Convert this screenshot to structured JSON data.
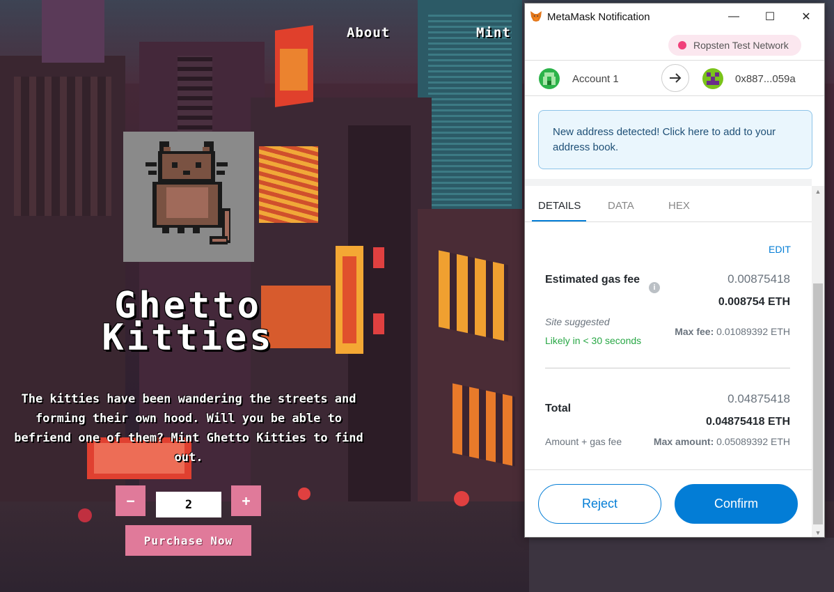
{
  "site": {
    "nav": {
      "about": "About",
      "mint": "Mint"
    },
    "title": "Ghetto Kitties",
    "description": "The kitties have been wandering the streets and forming their own hood. Will you be able to befriend one of them? Mint Ghetto Kitties to find out.",
    "quantity": {
      "minus_label": "−",
      "value": "2",
      "plus_label": "+"
    },
    "purchase_label": "Purchase Now",
    "accent_color": "#e07a9a"
  },
  "metamask": {
    "window_title": "MetaMask Notification",
    "window_controls": {
      "minimize": "—",
      "maximize": "☐",
      "close": "✕"
    },
    "network": "Ropsten Test Network",
    "from_account": "Account 1",
    "to_address": "0x887...059a",
    "notice": "New address detected! Click here to add to your address book.",
    "tabs": [
      "DETAILS",
      "DATA",
      "HEX"
    ],
    "active_tab": "DETAILS",
    "edit_label": "EDIT",
    "gas": {
      "label": "Estimated gas fee",
      "value_secondary": "0.00875418",
      "value_primary": "0.008754 ETH",
      "site_suggested": "Site suggested",
      "timing": "Likely in < 30 seconds",
      "max_fee_label": "Max fee:",
      "max_fee_value": "0.01089392 ETH"
    },
    "total": {
      "label": "Total",
      "value_secondary": "0.04875418",
      "value_primary": "0.04875418 ETH",
      "sub_label": "Amount + gas fee",
      "max_amount_label": "Max amount:",
      "max_amount_value": "0.05089392 ETH"
    },
    "reject_label": "Reject",
    "confirm_label": "Confirm",
    "primary_color": "#037dd6"
  }
}
